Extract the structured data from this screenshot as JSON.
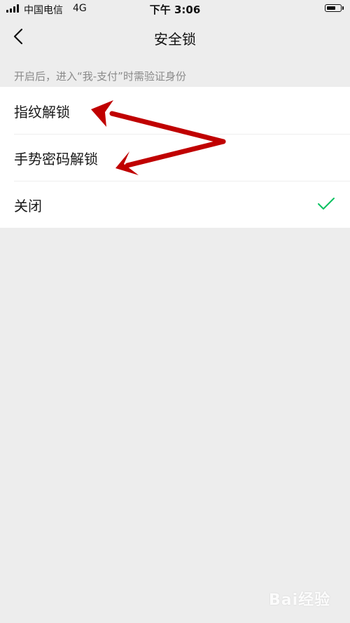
{
  "status_bar": {
    "carrier": "中国电信",
    "network": "4G",
    "time": "下午 3:06",
    "battery_level": 0.7
  },
  "nav": {
    "back_icon": "chevron-left-icon",
    "title": "安全锁"
  },
  "section": {
    "hint": "开启后，进入“我-支付”时需验证身份"
  },
  "options": [
    {
      "label": "指纹解锁",
      "selected": false
    },
    {
      "label": "手势密码解锁",
      "selected": false
    },
    {
      "label": "关闭",
      "selected": true
    }
  ],
  "colors": {
    "background": "#ededed",
    "accent_check": "#07c160",
    "annotation_arrow": "#c00000"
  },
  "watermark": {
    "text": "Bai经验"
  }
}
